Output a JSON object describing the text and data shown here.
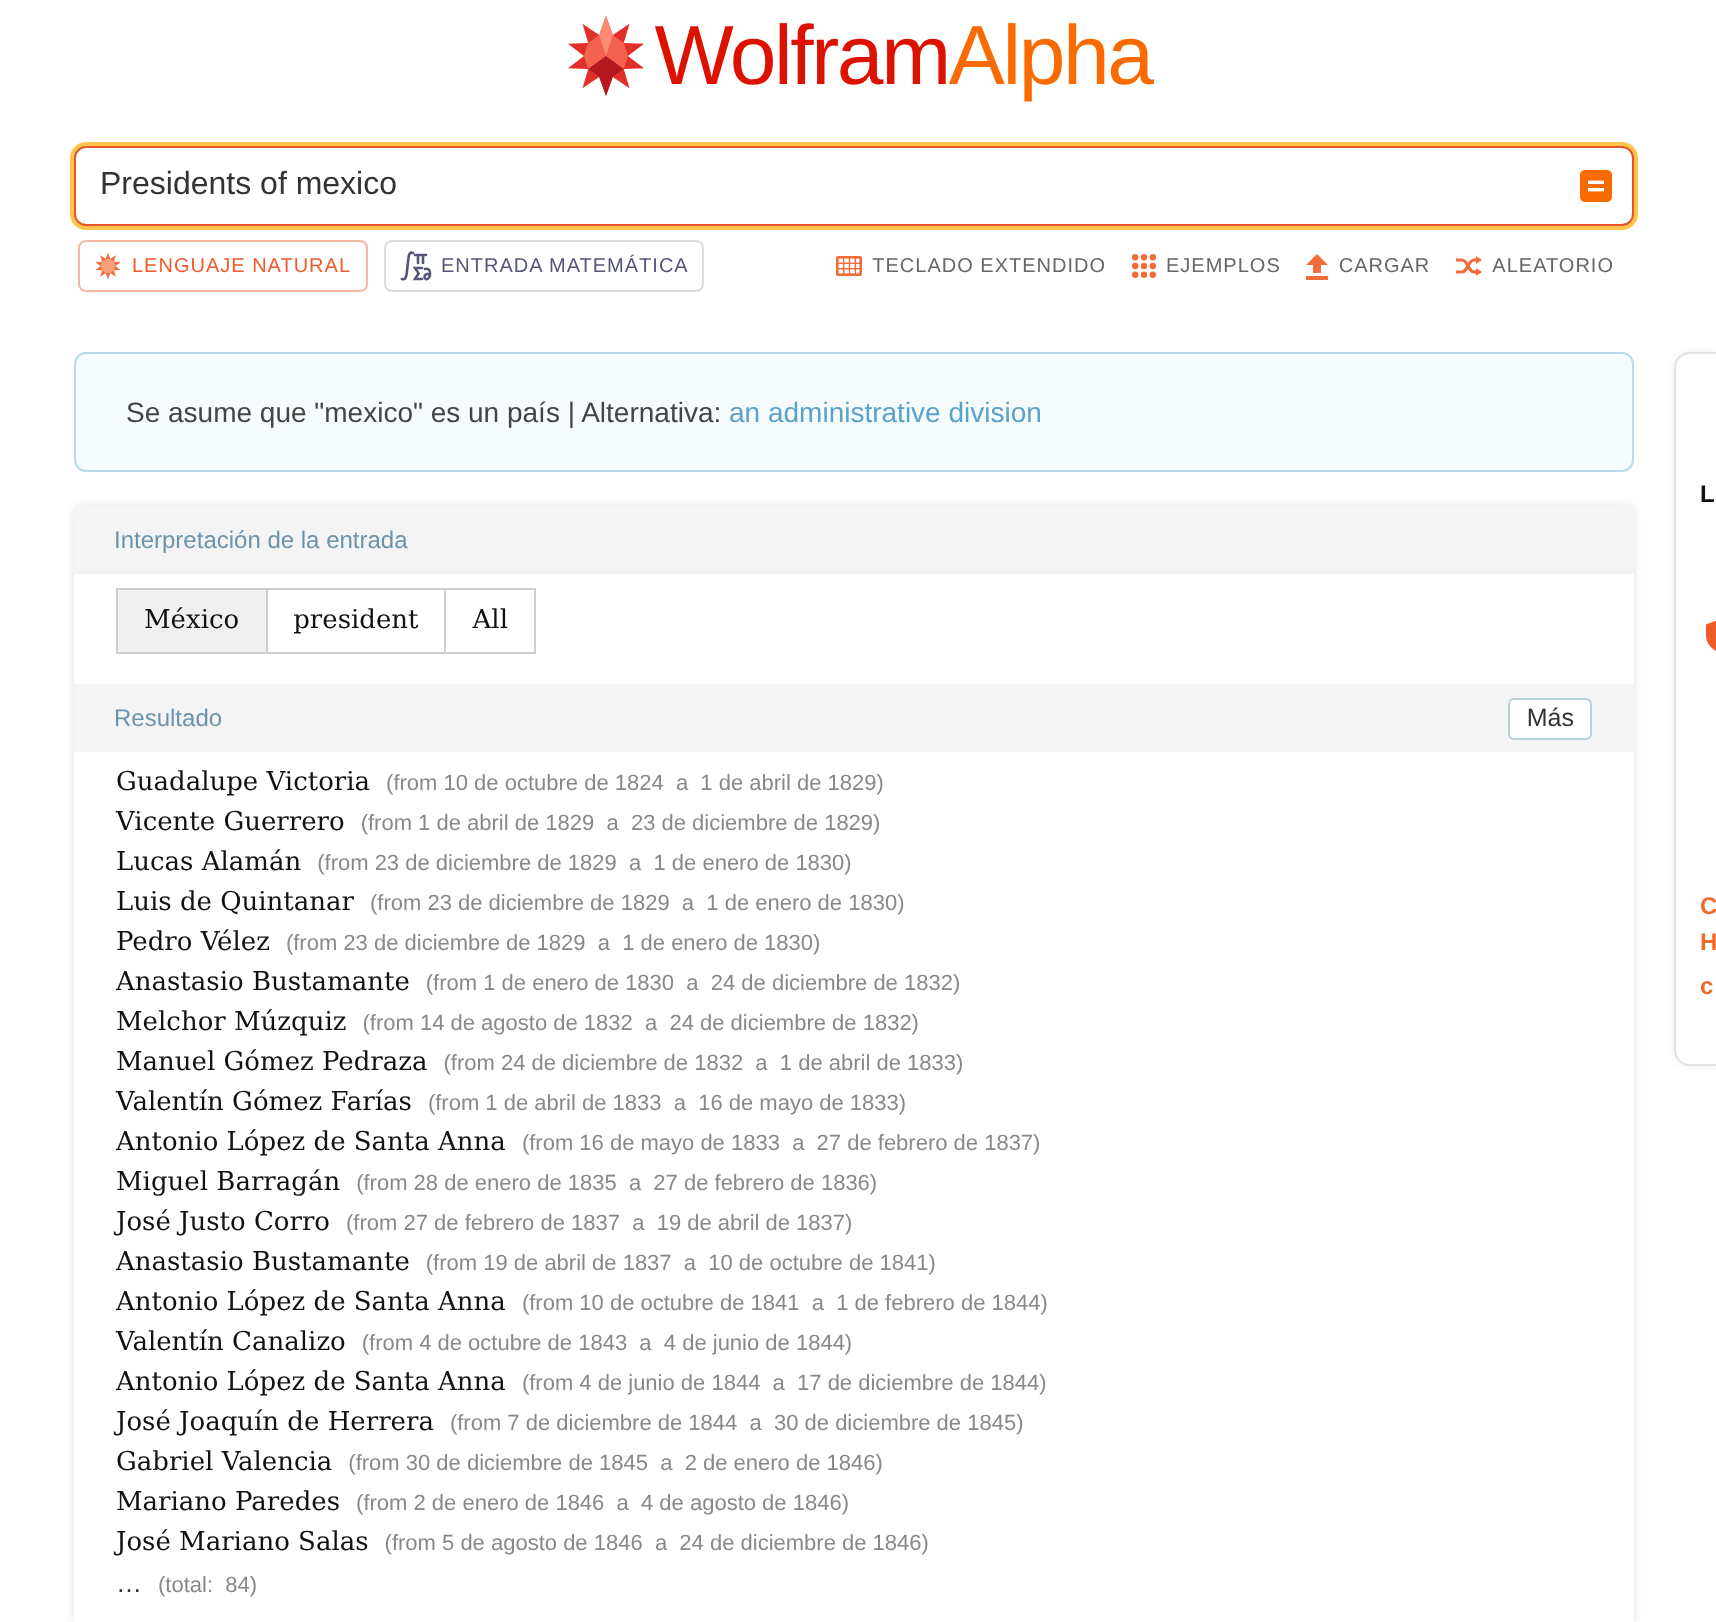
{
  "logo": {
    "parts": [
      "Wolfram",
      "Alpha"
    ]
  },
  "search": {
    "value": "Presidents of mexico"
  },
  "input_modes": [
    {
      "label": "LENGUAJE NATURAL",
      "kind": "natural",
      "selected": true
    },
    {
      "label": "ENTRADA MATEMÁTICA",
      "kind": "math",
      "selected": false
    }
  ],
  "tools": [
    {
      "label": "TECLADO EXTENDIDO",
      "kind": "keyboard"
    },
    {
      "label": "EJEMPLOS",
      "kind": "examples"
    },
    {
      "label": "CARGAR",
      "kind": "upload"
    },
    {
      "label": "ALEATORIO",
      "kind": "random"
    }
  ],
  "assumption": {
    "text": "Se asume que \"mexico\" es un país | Alternativa:",
    "link": "an administrative division"
  },
  "interpretation": {
    "title": "Interpretación de la entrada",
    "options": [
      {
        "label": "México",
        "selected": true
      },
      {
        "label": "president",
        "selected": false
      },
      {
        "label": "All",
        "selected": false
      }
    ]
  },
  "result": {
    "title": "Resultado",
    "more_button": "Más",
    "rows": [
      {
        "name": "Guadalupe Victoria",
        "term": "(from 10 de octubre de 1824  a  1 de abril de 1829)"
      },
      {
        "name": "Vicente Guerrero",
        "term": "(from 1 de abril de 1829  a  23 de diciembre de 1829)"
      },
      {
        "name": "Lucas Alamán",
        "term": "(from 23 de diciembre de 1829  a  1 de enero de 1830)"
      },
      {
        "name": "Luis de Quintanar",
        "term": "(from 23 de diciembre de 1829  a  1 de enero de 1830)"
      },
      {
        "name": "Pedro Vélez",
        "term": "(from 23 de diciembre de 1829  a  1 de enero de 1830)"
      },
      {
        "name": "Anastasio Bustamante",
        "term": "(from 1 de enero de 1830  a  24 de diciembre de 1832)"
      },
      {
        "name": "Melchor Múzquiz",
        "term": "(from 14 de agosto de 1832  a  24 de diciembre de 1832)"
      },
      {
        "name": "Manuel Gómez Pedraza",
        "term": "(from 24 de diciembre de 1832  a  1 de abril de 1833)"
      },
      {
        "name": "Valentín Gómez Farías",
        "term": "(from 1 de abril de 1833  a  16 de mayo de 1833)"
      },
      {
        "name": "Antonio López de Santa Anna",
        "term": "(from 16 de mayo de 1833  a  27 de febrero de 1837)"
      },
      {
        "name": "Miguel Barragán",
        "term": "(from 28 de enero de 1835  a  27 de febrero de 1836)"
      },
      {
        "name": "José Justo Corro",
        "term": "(from 27 de febrero de 1837  a  19 de abril de 1837)"
      },
      {
        "name": "Anastasio Bustamante",
        "term": "(from 19 de abril de 1837  a  10 de octubre de 1841)"
      },
      {
        "name": "Antonio López de Santa Anna",
        "term": "(from 10 de octubre de 1841  a  1 de febrero de 1844)"
      },
      {
        "name": "Valentín Canalizo",
        "term": "(from 4 de octubre de 1843  a  4 de junio de 1844)"
      },
      {
        "name": "Antonio López de Santa Anna",
        "term": "(from 4 de junio de 1844  a  17 de diciembre de 1844)"
      },
      {
        "name": "José Joaquín de Herrera",
        "term": "(from 7 de diciembre de 1844  a  30 de diciembre de 1845)"
      },
      {
        "name": "Gabriel Valencia",
        "term": "(from 30 de diciembre de 1845  a  2 de enero de 1846)"
      },
      {
        "name": "Mariano Paredes",
        "term": "(from 2 de enero de 1846  a  4 de agosto de 1846)"
      },
      {
        "name": "José Mariano Salas",
        "term": "(from 5 de agosto de 1846  a  24 de diciembre de 1846)"
      }
    ],
    "ellipsis": "…",
    "total": "(total:  84)"
  },
  "side_card": {
    "heading": "L",
    "lines": [
      "C",
      "H",
      "c"
    ]
  }
}
